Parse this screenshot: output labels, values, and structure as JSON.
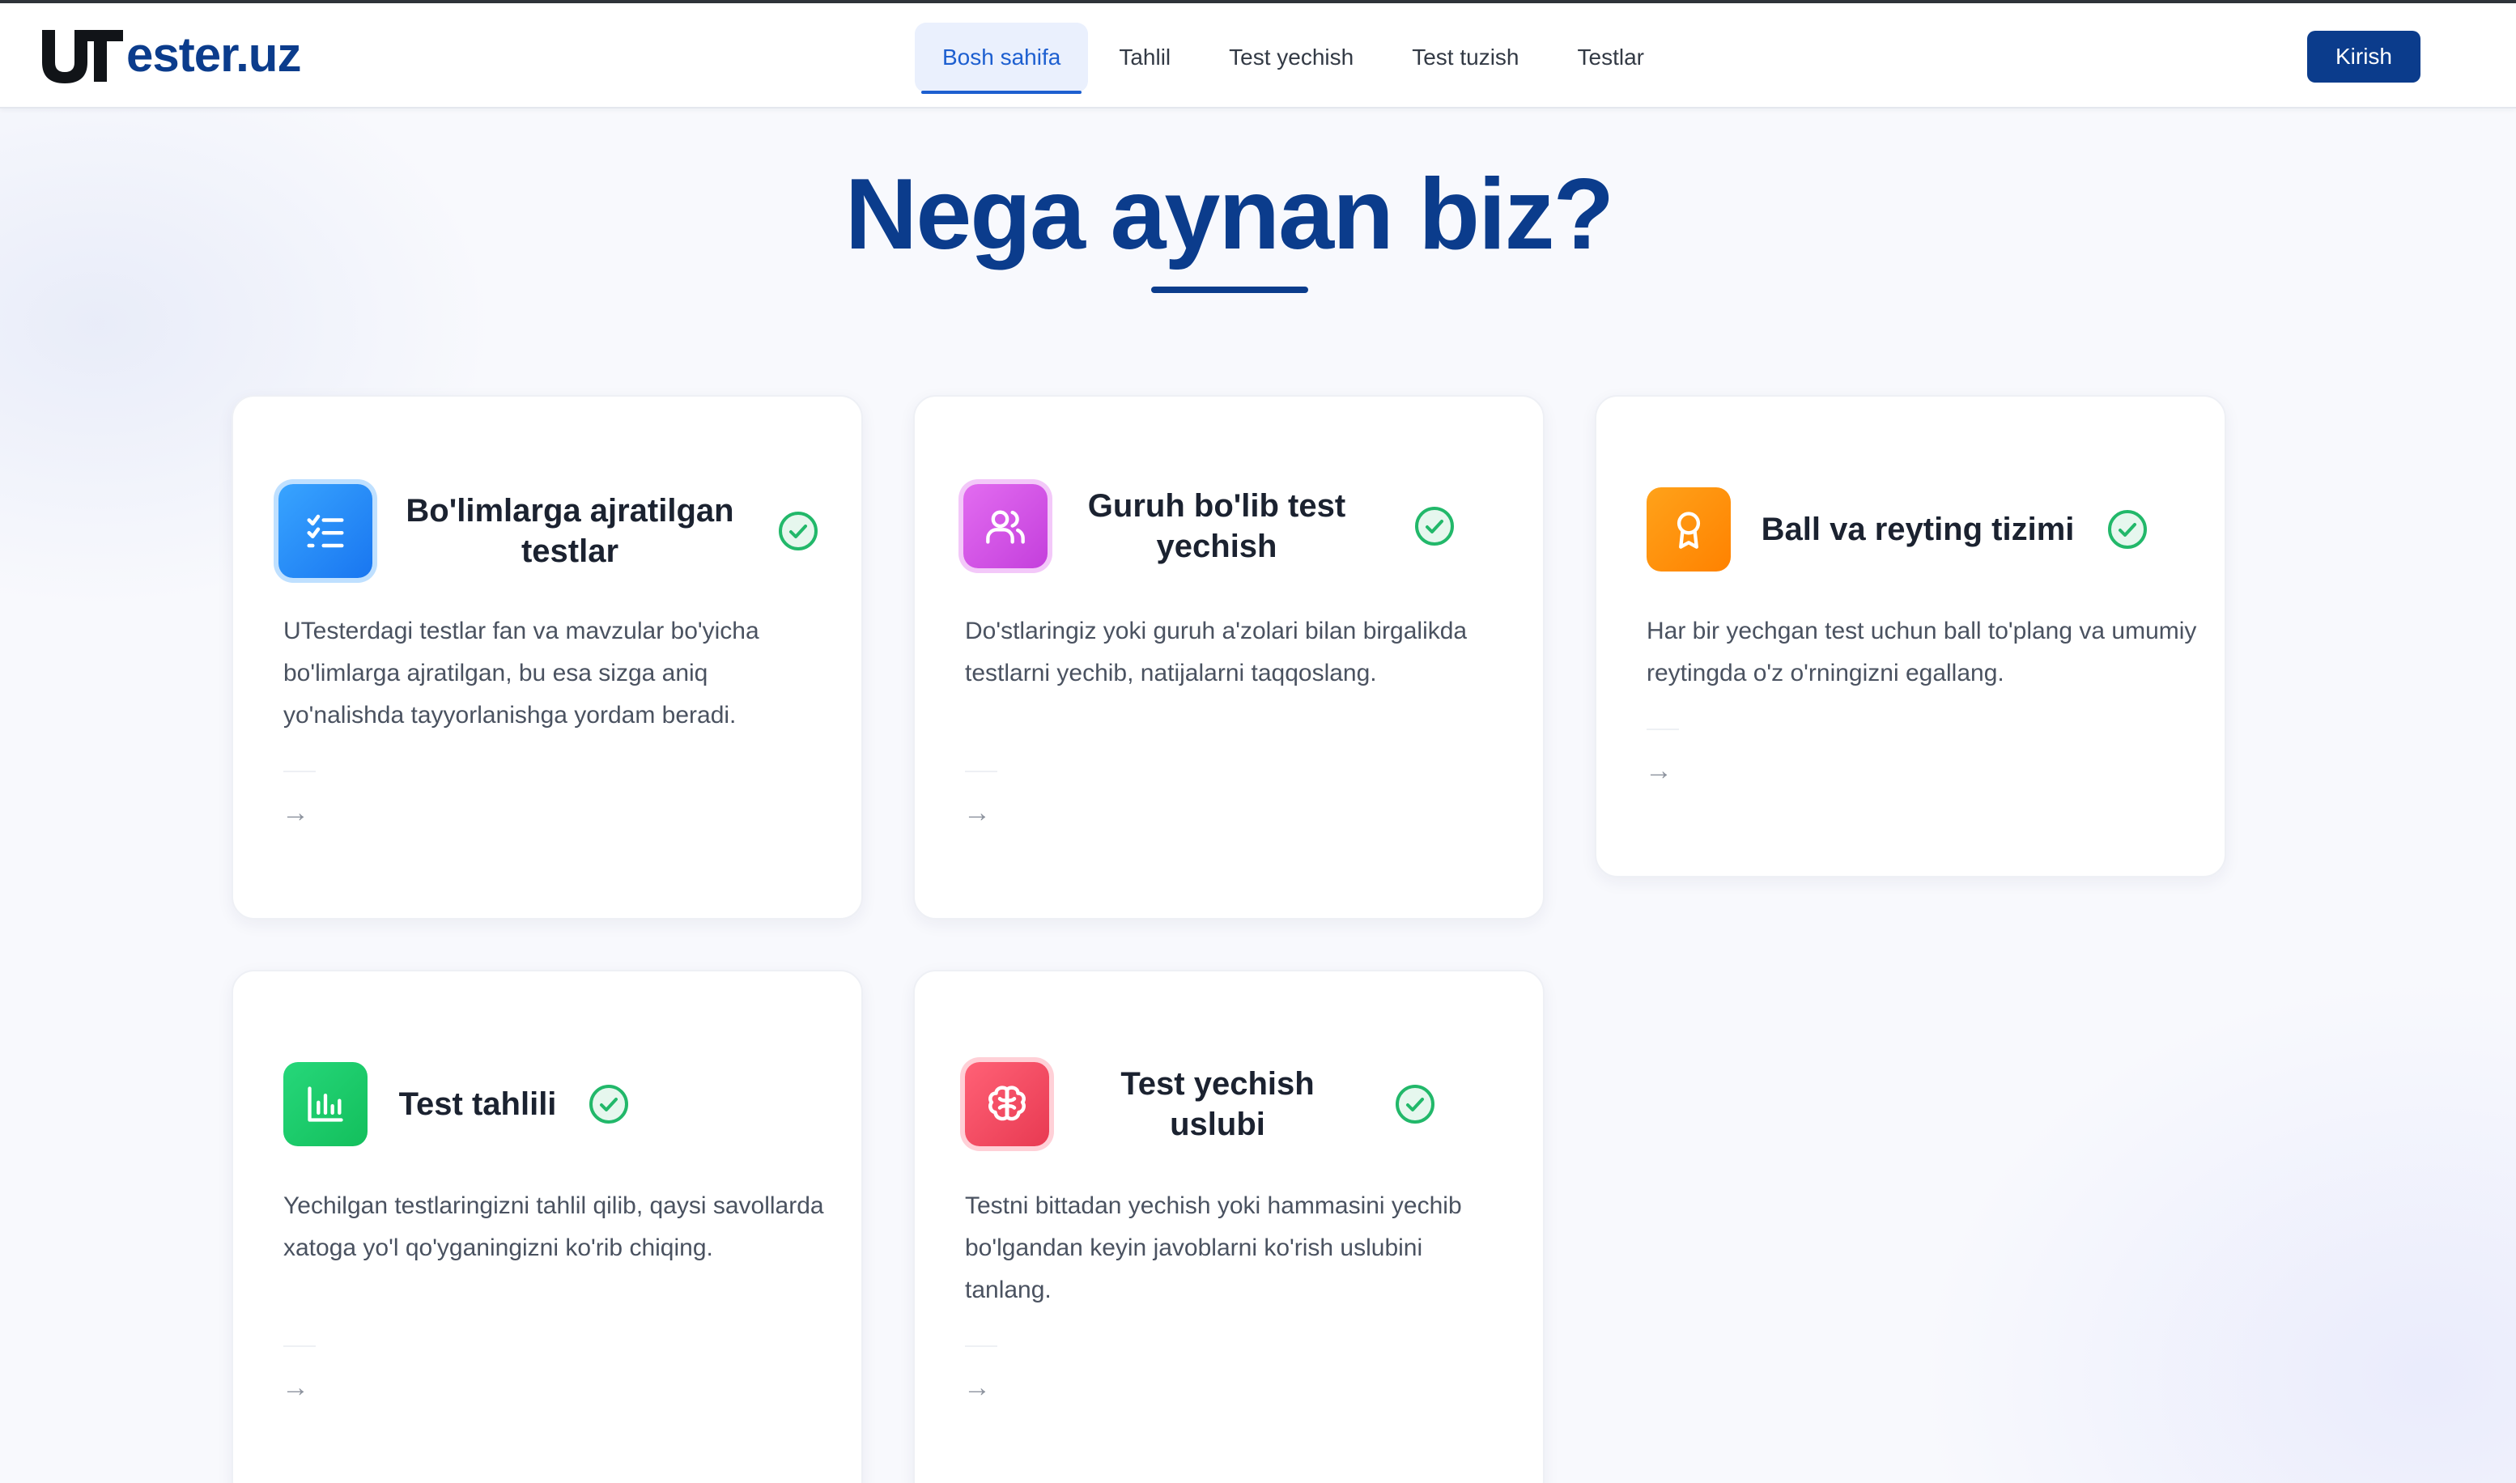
{
  "brand": {
    "logo_text": "ester.uz",
    "logo_mark": "UT"
  },
  "nav": {
    "items": [
      {
        "label": "Bosh sahifa",
        "active": true
      },
      {
        "label": "Tahlil",
        "active": false
      },
      {
        "label": "Test yechish",
        "active": false
      },
      {
        "label": "Test tuzish",
        "active": false
      },
      {
        "label": "Testlar",
        "active": false
      }
    ],
    "login_label": "Kirish"
  },
  "hero": {
    "title": "Nega aynan biz?"
  },
  "features": [
    {
      "title": "Bo'limlarga ajratilgan testlar",
      "description": "UTesterdagi testlar fan va mavzular bo'yicha bo'limlarga ajratilgan, bu esa sizga aniq yo'nalishda tayyorlanishga yordam beradi.",
      "icon": "checklist-icon",
      "color": "#1e90ff",
      "arrow": "→"
    },
    {
      "title": "Guruh bo'lib test yechish",
      "description": "Do'stlaringiz yoki guruh a'zolari bilan birgalikda testlarni yechib, natijalarni taqqoslang.",
      "icon": "users-icon",
      "color": "#d14fe0",
      "arrow": "→"
    },
    {
      "title": "Ball va reyting tizimi",
      "description": "Har bir yechgan test uchun ball to'plang va umumiy reytingda o'z o'rningizni egallang.",
      "icon": "award-icon",
      "color": "#ff8a00",
      "arrow": "→"
    },
    {
      "title": "Test tahlili",
      "description": "Yechilgan testlaringizni tahlil qilib, qaysi savollarda xatoga yo'l qo'yganingizni ko'rib chiqing.",
      "icon": "bar-chart-icon",
      "color": "#1ccb6a",
      "arrow": "→"
    },
    {
      "title": "Test yechish uslubi",
      "description": "Testni bittadan yechish yoki hammasini yechib bo'lgandan keyin javoblarni ko'rish uslubini tanlang.",
      "icon": "brain-icon",
      "color": "#f04c61",
      "arrow": "→"
    }
  ],
  "colors": {
    "primary": "#0b3c8c",
    "nav_active": "#1d5fd0",
    "check": "#22b86a"
  }
}
